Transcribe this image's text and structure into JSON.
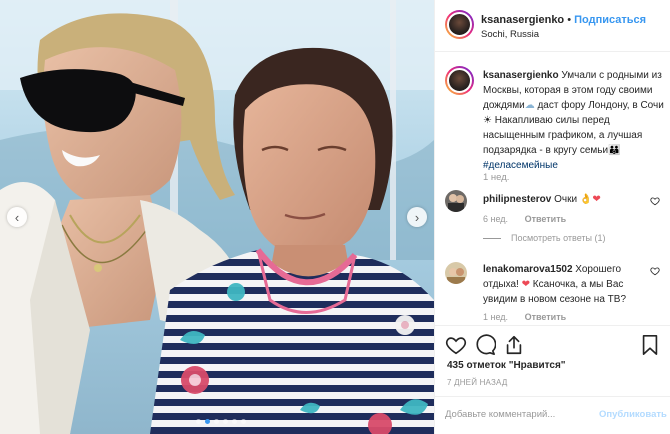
{
  "post": {
    "author": "ksanasergienko",
    "separator": "•",
    "follow_label": "Подписаться",
    "location": "Sochi, Russia"
  },
  "caption": {
    "username": "ksanasergienko",
    "text_1": "Умчали с родными из Москвы, которая в этом году своими дождями",
    "emoji_1": "☁",
    "text_2": "даст фору Лондону, в Сочи",
    "emoji_2": "☀",
    "text_3": "Накапливаю силы перед насыщенным графиком, а лучшая подзарядка - в кругу семьи",
    "emoji_3": "👪",
    "hashtag": "#деласемейные",
    "time": "1 нед."
  },
  "comments": [
    {
      "username": "philipnesterov",
      "text": "Очки",
      "emoji": "👌❤",
      "time": "6 нед.",
      "reply_label": "Ответить",
      "view_replies": "Посмотреть ответы (1)"
    },
    {
      "username": "lenakomarova1502",
      "text": "Хорошего отдыха!",
      "emoji": "❤",
      "text_2": "Ксаночка, а мы Вас увидим в новом сезоне на ТВ?",
      "time": "1 нед.",
      "reply_label": "Ответить"
    }
  ],
  "actions": {
    "icons": [
      "heart-icon",
      "comment-icon",
      "share-icon",
      "bookmark-icon"
    ]
  },
  "likes_label": "435 отметок \"Нравится\"",
  "posted_label": "7 ДНЕЙ НАЗАД",
  "add_comment": {
    "placeholder": "Добавьте комментарий...",
    "publish_label": "Опубликовать"
  },
  "photo": {
    "nav_prev": "‹",
    "nav_next": "›",
    "slides": 6,
    "active_slide": 2
  },
  "colors": {
    "link": "#3897f0",
    "hashtag": "#003569",
    "muted": "#999999",
    "text": "#262626",
    "border": "#efefef",
    "heart": "#ed4956"
  }
}
